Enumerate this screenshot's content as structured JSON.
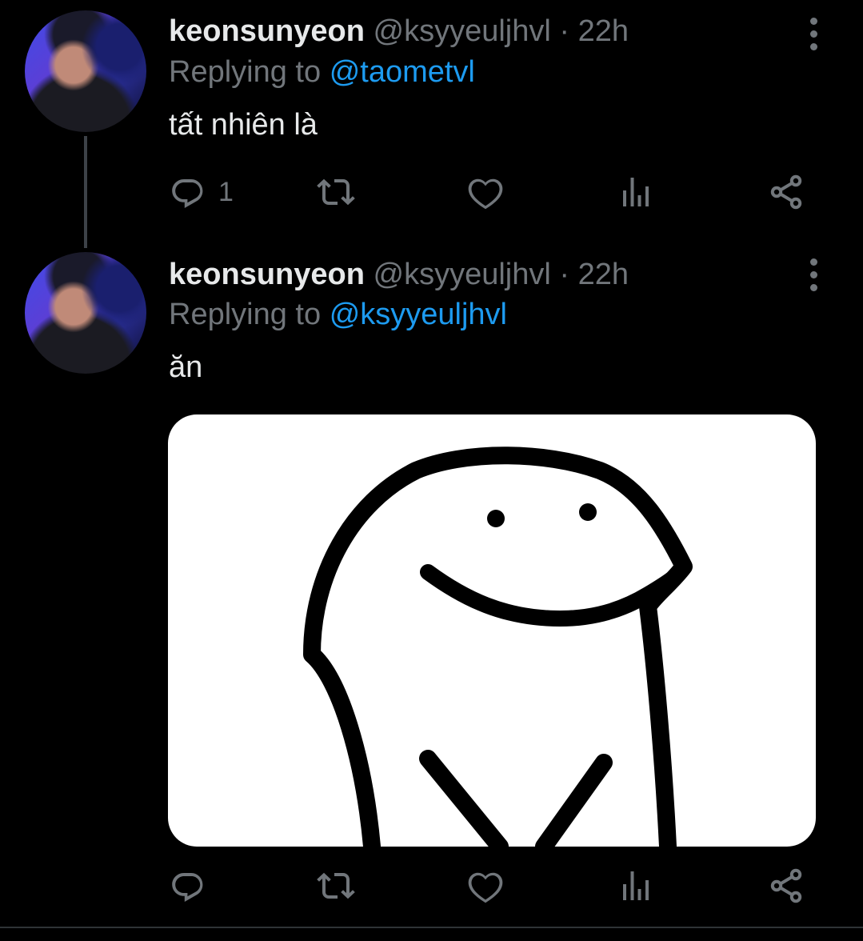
{
  "tweets": [
    {
      "name": "keonsunyeon",
      "handle": "@ksyyeuljhvl",
      "separator": "·",
      "time": "22h",
      "replying_prefix": "Replying to",
      "replying_to": "@taometvl",
      "text": "tất nhiên là",
      "reply_count": "1"
    },
    {
      "name": "keonsunyeon",
      "handle": "@ksyyeuljhvl",
      "separator": "·",
      "time": "22h",
      "replying_prefix": "Replying to",
      "replying_to": "@ksyyeuljhvl",
      "text": "ăn",
      "reply_count": ""
    }
  ],
  "icons": {
    "reply": "reply-icon",
    "retweet": "retweet-icon",
    "like": "heart-icon",
    "stats": "analytics-icon",
    "share": "share-icon",
    "more": "more-vertical-icon"
  },
  "colors": {
    "background": "#000000",
    "text": "#e7e9ea",
    "muted": "#71767b",
    "link": "#1d9bf0"
  }
}
